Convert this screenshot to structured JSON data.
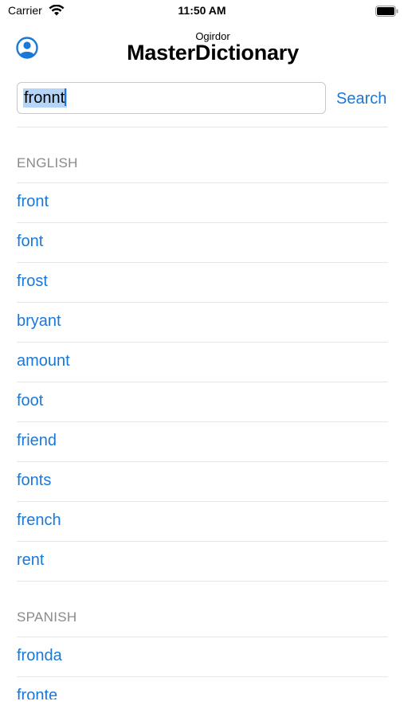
{
  "status_bar": {
    "carrier": "Carrier",
    "time": "11:50 AM"
  },
  "header": {
    "brand_sub": "Ogirdor",
    "brand_title": "MasterDictionary",
    "account_icon": "person-circle-icon"
  },
  "search": {
    "value": "fronnt",
    "button_label": "Search"
  },
  "sections": [
    {
      "title": "ENGLISH",
      "items": [
        "front",
        "font",
        "frost",
        "bryant",
        "amount",
        "foot",
        "friend",
        "fonts",
        "french",
        "rent"
      ]
    },
    {
      "title": "SPANISH",
      "items": [
        "fronda",
        "fronte"
      ]
    }
  ],
  "colors": {
    "accent": "#1a78d8",
    "section_header": "#8a8a8a",
    "selection": "#b4d5f7"
  }
}
